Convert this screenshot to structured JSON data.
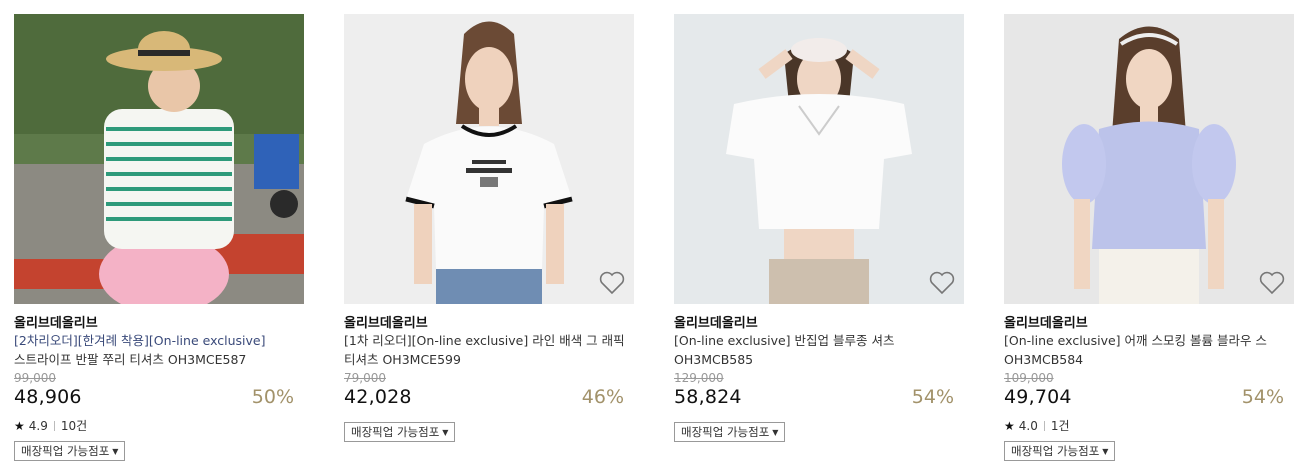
{
  "products": [
    {
      "brand": "올리브데올리브",
      "tag": "[2차리오더][한겨례 착용][On-line exclusive]",
      "title": "스트라이프 반팔 쭈리 티셔츠 OH3MCE587",
      "original_price": "99,000",
      "price": "48,906",
      "discount": "50%",
      "rating": "4.9",
      "reviews": "10건",
      "pickup_label": "매장픽업 가능점포",
      "icon": "wishlist-heart-icon"
    },
    {
      "brand": "올리브데올리브",
      "tag": "[1차 리오더][On-line exclusive]",
      "title": "라인 배색 그 래픽 티셔츠 OH3MCE599",
      "original_price": "79,000",
      "price": "42,028",
      "discount": "46%",
      "pickup_label": "매장픽업 가능점포",
      "icon": "wishlist-heart-icon"
    },
    {
      "brand": "올리브데올리브",
      "tag": "[On-line exclusive]",
      "title": "반집업 블루종 셔츠 OH3MCB585",
      "original_price": "129,000",
      "price": "58,824",
      "discount": "54%",
      "pickup_label": "매장픽업 가능점포",
      "icon": "wishlist-heart-icon"
    },
    {
      "brand": "올리브데올리브",
      "tag": "[On-line exclusive]",
      "title": "어깨 스모킹 볼륨 블라우 스 OH3MCB584",
      "original_price": "109,000",
      "price": "49,704",
      "discount": "54%",
      "rating": "4.0",
      "reviews": "1건",
      "pickup_label": "매장픽업 가능점포",
      "icon": "wishlist-heart-icon"
    }
  ],
  "colors": {
    "discount": "#a2926a",
    "tag": "#3a4a7a"
  }
}
